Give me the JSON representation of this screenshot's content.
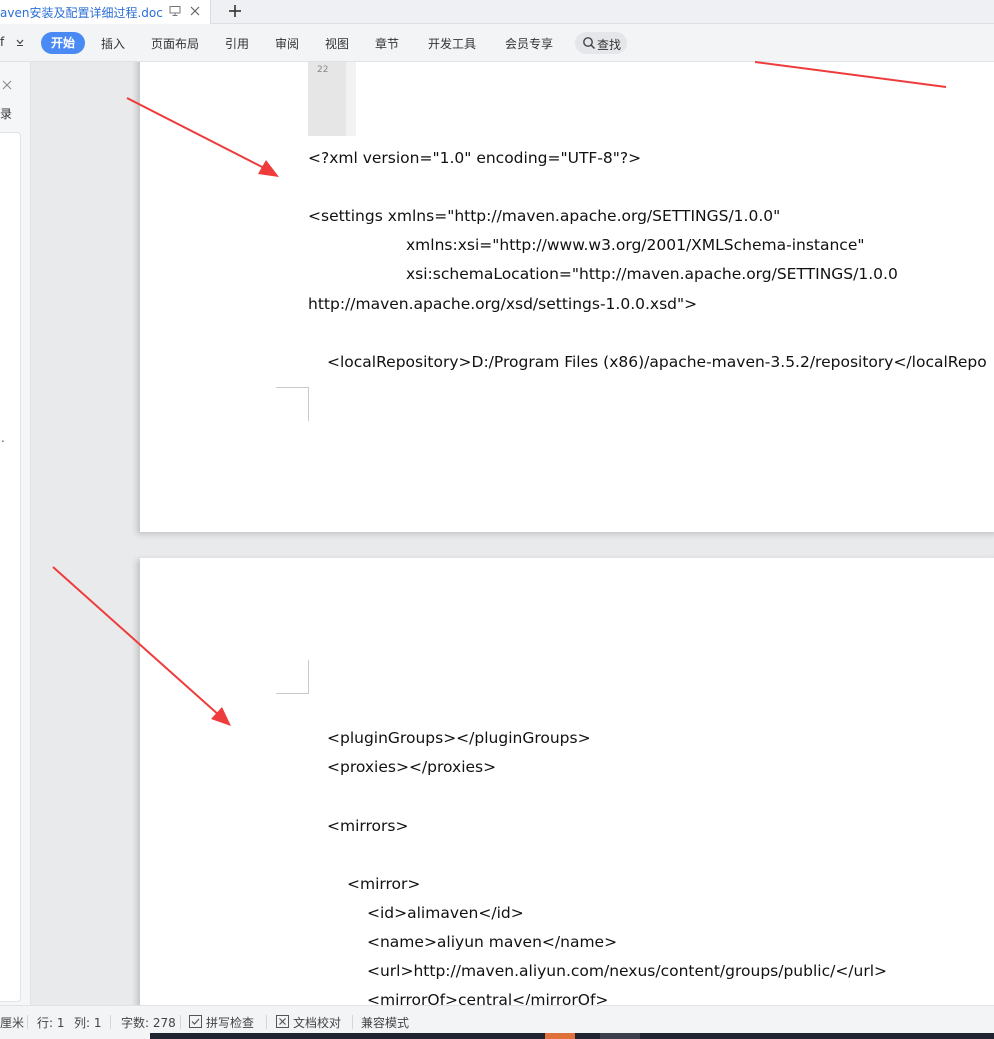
{
  "tab": {
    "title": "aven安装及配置详细过程.doc",
    "add_label": "+"
  },
  "ribbon": {
    "left_fragment": "f",
    "active": "开始",
    "items": [
      "插入",
      "页面布局",
      "引用",
      "审阅",
      "视图",
      "章节",
      "开发工具",
      "会员专享"
    ],
    "search_label": "查找"
  },
  "navpane": {
    "label": "目录",
    "fragment": "."
  },
  "page1": {
    "gutter_number": "22",
    "lines": [
      "<?xml version=\"1.0\" encoding=\"UTF-8\"?>",
      "<settings xmlns=\"http://maven.apache.org/SETTINGS/1.0.0\"",
      "xmlns:xsi=\"http://www.w3.org/2001/XMLSchema-instance\"",
      "xsi:schemaLocation=\"http://maven.apache.org/SETTINGS/1.0.0",
      "http://maven.apache.org/xsd/settings-1.0.0.xsd\">",
      "<localRepository>D:/Program Files (x86)/apache-maven-3.5.2/repository</localRepo"
    ]
  },
  "page2": {
    "lines": [
      "<pluginGroups></pluginGroups>",
      "<proxies></proxies>",
      "<mirrors>",
      "<mirror>",
      "<id>alimaven</id>",
      "<name>aliyun maven</name>",
      "<url>http://maven.aliyun.com/nexus/content/groups/public/</url>",
      "<mirrorOf>central</mirrorOf>"
    ]
  },
  "statusbar": {
    "unit": "厘米",
    "row": "行: 1",
    "col": "列: 1",
    "word_count": "字数: 278",
    "spell_check": "拼写检查",
    "doc_proof": "文档校对",
    "compat_mode": "兼容模式"
  },
  "colors": {
    "accent": "#4a8af4",
    "tab_title": "#2b6fd6",
    "annotation_arrow": "#ee3b3b"
  }
}
